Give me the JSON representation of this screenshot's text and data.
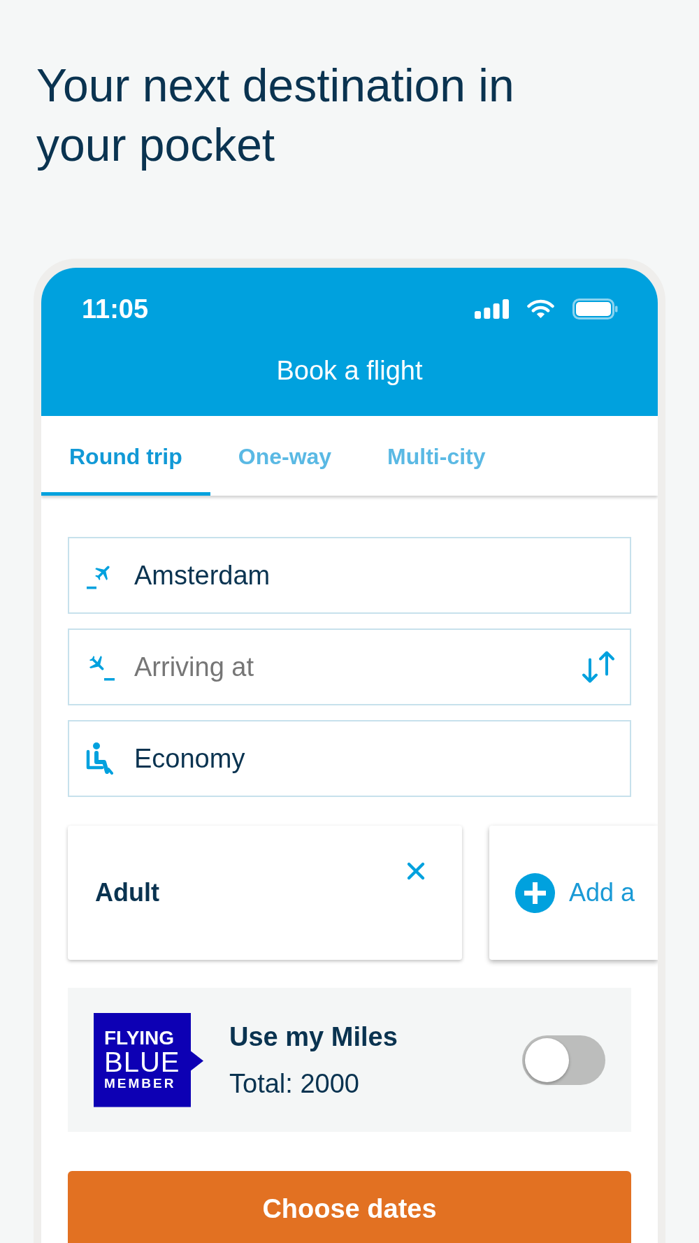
{
  "heading": "Your next destination in your pocket",
  "status_bar": {
    "time": "11:05"
  },
  "header": {
    "title": "Book a flight"
  },
  "tabs": [
    {
      "label": "Round trip",
      "selected": true
    },
    {
      "label": "One-way",
      "selected": false
    },
    {
      "label": "Multi-city",
      "selected": false
    }
  ],
  "fields": [
    {
      "kind": "departure",
      "value": "Amsterdam",
      "swap_button": false
    },
    {
      "kind": "arrival",
      "placeholder": "Arriving at",
      "swap_button": true
    },
    {
      "kind": "cabin",
      "value": "Economy",
      "swap_button": false
    }
  ],
  "passengers": [
    {
      "kind": "passenger",
      "label": "Adult"
    },
    {
      "kind": "add",
      "label": "Add a"
    }
  ],
  "miles": {
    "logo": [
      "FLYING",
      "BLUE",
      "MEMBER"
    ],
    "title": "Use my Miles",
    "total": "Total: 2000",
    "on": false
  },
  "primary_button": {
    "label": "Choose dates"
  }
}
